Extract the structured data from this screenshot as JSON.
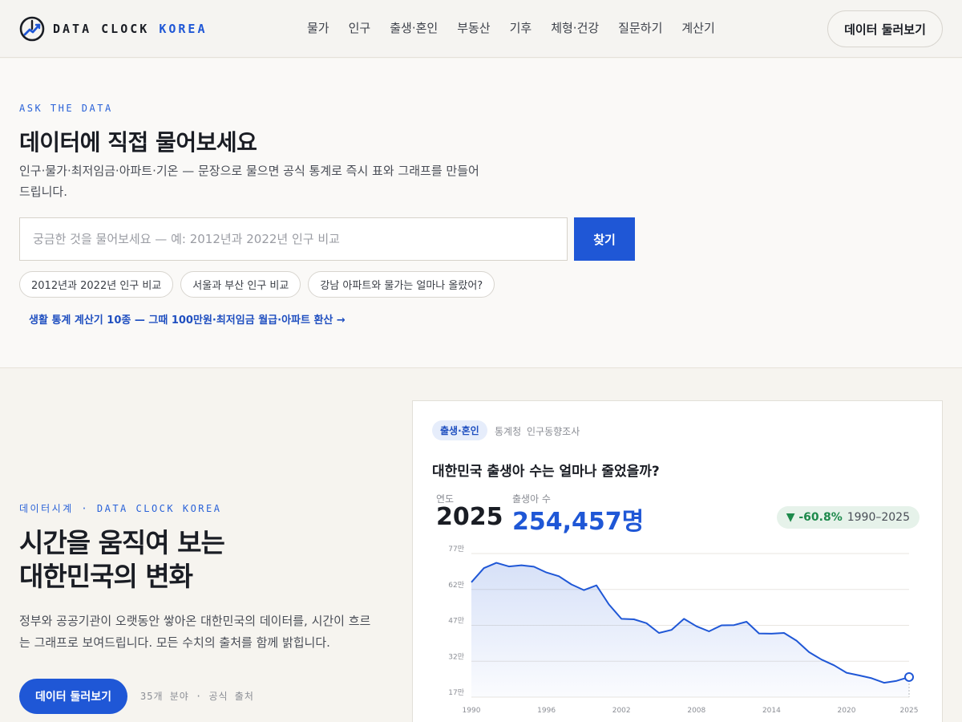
{
  "header": {
    "logo_text": "DATA CLOCK",
    "logo_accent": "KOREA",
    "nav": [
      "물가",
      "인구",
      "출생·혼인",
      "부동산",
      "기후",
      "체형·건강",
      "질문하기",
      "계산기"
    ],
    "cta": "데이터 둘러보기"
  },
  "ask": {
    "eyebrow": "ASK THE DATA",
    "title": "데이터에 직접 물어보세요",
    "description": "인구·물가·최저임금·아파트·기온 — 문장으로 물으면 공식 통계로 즉시 표와 그래프를 만들어 드립니다.",
    "search_placeholder": "궁금한 것을 물어보세요 — 예: 2012년과 2022년 인구 비교",
    "search_button": "찾기",
    "chips": [
      "2012년과 2022년 인구 비교",
      "서울과 부산 인구 비교",
      "강남 아파트와 물가는 얼마나 올랐어?"
    ],
    "calc_link": "생활 통계 계산기 10종 — 그때 100만원·최저임금 월급·아파트 환산 →"
  },
  "hero": {
    "eyebrow": "데이터시계 · DATA CLOCK KOREA",
    "title_line1": "시간을 움직여 보는",
    "title_line2": "대한민국의 변화",
    "description": "정부와 공공기관이 오랫동안 쌓아온 대한민국의 데이터를, 시간이 흐르는 그래프로 보여드립니다. 모든 수치의 출처를 함께 밝힙니다.",
    "button": "데이터 둘러보기",
    "meta": "35개 분야 · 공식 출처"
  },
  "card": {
    "tag": "출생·혼인",
    "source_org": "통계청",
    "source_survey": "인구동향조사",
    "question": "대한민국 출생아 수는 얼마나 줄었을까?",
    "year_label": "연도",
    "year_value": "2025",
    "births_label": "출생아 수",
    "births_value": "254,457명",
    "delta_value": "▼ -60.8%",
    "delta_range": "1990–2025",
    "colors": {
      "accent": "#1f57d6",
      "positive_bg": "#e6f2ea",
      "delta_text": "#1e8a4c"
    }
  },
  "chart_data": {
    "type": "area",
    "title": "대한민국 출생아 수는 얼마나 줄었을까?",
    "xlabel": "",
    "ylabel": "",
    "x_ticks": [
      "1990",
      "1996",
      "2002",
      "2008",
      "2014",
      "2020",
      "2025"
    ],
    "y_ticks": [
      "77만",
      "62만",
      "47만",
      "32만",
      "17만"
    ],
    "ylim": [
      17,
      77
    ],
    "grid": true,
    "x": [
      1990,
      1991,
      1992,
      1993,
      1994,
      1995,
      1996,
      1997,
      1998,
      1999,
      2000,
      2001,
      2002,
      2003,
      2004,
      2005,
      2006,
      2007,
      2008,
      2009,
      2010,
      2011,
      2012,
      2013,
      2014,
      2015,
      2016,
      2017,
      2018,
      2019,
      2020,
      2021,
      2022,
      2023,
      2024,
      2025
    ],
    "values": [
      65,
      70.9,
      73.1,
      71.6,
      72.1,
      71.5,
      69.1,
      67.5,
      64.1,
      61.7,
      63.7,
      55.7,
      49.7,
      49.5,
      47.9,
      43.8,
      45.1,
      49.7,
      46.6,
      44.5,
      47.0,
      47.1,
      48.5,
      43.6,
      43.5,
      43.8,
      40.6,
      35.8,
      32.7,
      30.3,
      27.2,
      26.1,
      24.9,
      23.0,
      23.8,
      25.4
    ]
  }
}
